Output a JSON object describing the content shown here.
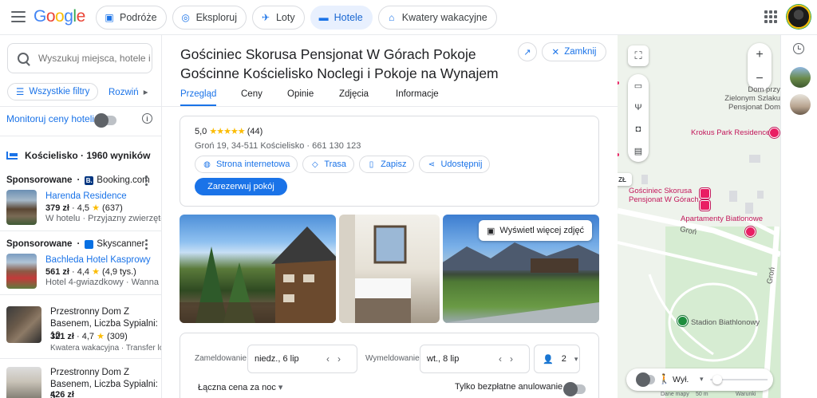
{
  "header": {
    "logo": "Google",
    "chips": [
      {
        "label": "Podróże",
        "icon": "travel-bag-icon",
        "active": false
      },
      {
        "label": "Eksploruj",
        "icon": "explore-icon",
        "active": false
      },
      {
        "label": "Loty",
        "icon": "flight-icon",
        "active": false
      },
      {
        "label": "Hotele",
        "icon": "bed-icon",
        "active": true
      },
      {
        "label": "Kwatery wakacyjne",
        "icon": "house-icon",
        "active": false
      }
    ]
  },
  "left_panel": {
    "search_placeholder": "Wyszukuj miejsca, hotele i ni...",
    "filters_label": "Wszystkie filtry",
    "expand_label": "Rozwiń",
    "monitor_label": "Monitoruj ceny hoteli",
    "results_header": "Kościelisko · 1960 wyników",
    "sponsored": [
      {
        "label": "Sponsorowane",
        "provider": "Booking.com",
        "name": "Harenda Residence",
        "price": "379 zł",
        "rating": "4,5",
        "reviews": "(637)",
        "desc": "W hotelu · Przyjazny zwierzętom"
      },
      {
        "label": "Sponsorowane",
        "provider": "Skyscanner",
        "name": "Bachleda Hotel Kasprowy",
        "price": "561 zł",
        "rating": "4,4",
        "reviews": "(4,9 tys.)",
        "desc": "Hotel 4-gwiazdkowy · Wanna z hydromasażem"
      }
    ],
    "results": [
      {
        "name": "Przestronny Dom Z Basenem, Liczba Sypialni: 10",
        "price": "321 zł",
        "rating": "4,7",
        "reviews": "(309)",
        "desc": "Kwatera wakacyjna · Transfer lotniskowy"
      },
      {
        "name": "Przestronny Dom Z Basenem, Liczba Sypialni: 5",
        "price": "426 zł"
      }
    ]
  },
  "detail": {
    "title": "Gościniec Skorusa Pensjonat W Górach Pokoje Gościnne Kościelisko Noclegi i Pokoje na Wynajem",
    "close_label": "Zamknij",
    "tabs": [
      "Przegląd",
      "Ceny",
      "Opinie",
      "Zdjęcia",
      "Informacje"
    ],
    "rating_value": "5,0",
    "rating_stars": "★★★★★",
    "review_count": "(44)",
    "address": "Groń 19, 34-511 Kościelisko · 661 130 123",
    "actions": [
      {
        "label": "Strona internetowa",
        "icon": "globe-icon"
      },
      {
        "label": "Trasa",
        "icon": "directions-icon"
      },
      {
        "label": "Zapisz",
        "icon": "bookmark-icon"
      },
      {
        "label": "Udostępnij",
        "icon": "share-icon"
      }
    ],
    "reserve_label": "Zarezerwuj pokój",
    "more_photos_label": "Wyświetl więcej zdjęć",
    "booking": {
      "checkin_label": "Zameldowanie",
      "checkin_value": "niedz., 6 lip",
      "checkout_label": "Wymeldowanie",
      "checkout_value": "wt., 8 lip",
      "guests": "2",
      "total_label": "Łączna cena za noc",
      "free_cancel_label": "Tylko bezpłatne anulowanie"
    }
  },
  "map": {
    "labels": [
      {
        "text": "Dom przy Zielonym Szlaku Pensjonat Dom",
        "color": "#555555"
      },
      {
        "text": "Krokus Park Residence",
        "color": "#c2185b"
      },
      {
        "text": "Gościniec Skorusa Pensjonat W Górach...",
        "color": "#c2185b"
      },
      {
        "text": "Apartamenty Biatlonowe",
        "color": "#c2185b"
      },
      {
        "text": "Groń",
        "color": "#555555"
      },
      {
        "text": "Stadion Biathlonowy",
        "color": "#555555"
      }
    ],
    "layer_label": "Wył.",
    "scale_text": "Dane mapy",
    "scale_distance": "50 m",
    "terms_text": "Warunki",
    "road_label": "Groń",
    "badge": "ZŁ"
  },
  "colors": {
    "accent": "#1a73e8",
    "star": "#fbbc05",
    "map_pin": "#e91e63"
  }
}
